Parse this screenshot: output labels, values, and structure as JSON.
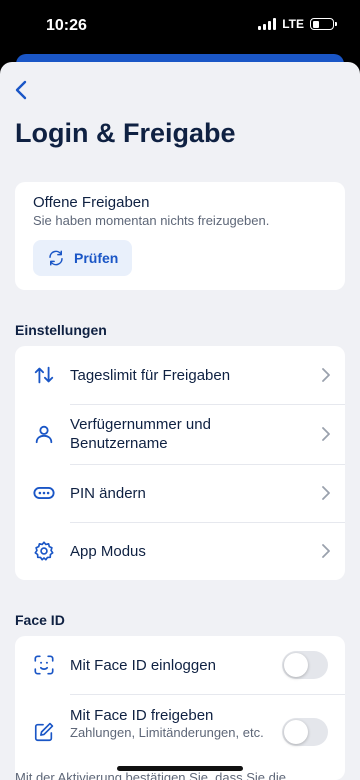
{
  "status_bar": {
    "time": "10:26",
    "network": "LTE"
  },
  "header": {
    "title": "Login & Freigabe"
  },
  "offene_freigaben": {
    "title": "Offene Freigaben",
    "subtitle": "Sie haben momentan nichts freizugeben.",
    "button_label": "Prüfen"
  },
  "einstellungen": {
    "heading": "Einstellungen",
    "items": [
      {
        "label": "Tageslimit für Freigaben",
        "icon": "arrows-up-down-icon"
      },
      {
        "label": "Verfügernummer und Benutzername",
        "icon": "person-icon"
      },
      {
        "label": "PIN ändern",
        "icon": "pin-dots-icon"
      },
      {
        "label": "App Modus",
        "icon": "gear-icon"
      }
    ]
  },
  "face_id": {
    "heading": "Face ID",
    "items": [
      {
        "label": "Mit Face ID einloggen",
        "subtext": "",
        "enabled": false,
        "icon": "face-id-icon"
      },
      {
        "label": "Mit Face ID freigeben",
        "subtext": "Zahlungen, Limitänderungen, etc.",
        "enabled": false,
        "icon": "edit-icon"
      }
    ]
  },
  "footer": {
    "text": "Mit der Aktivierung bestätigen Sie, dass Sie die"
  },
  "colors": {
    "accent": "#1a56c6",
    "text": "#0f2142",
    "background": "#f0f1f5"
  }
}
